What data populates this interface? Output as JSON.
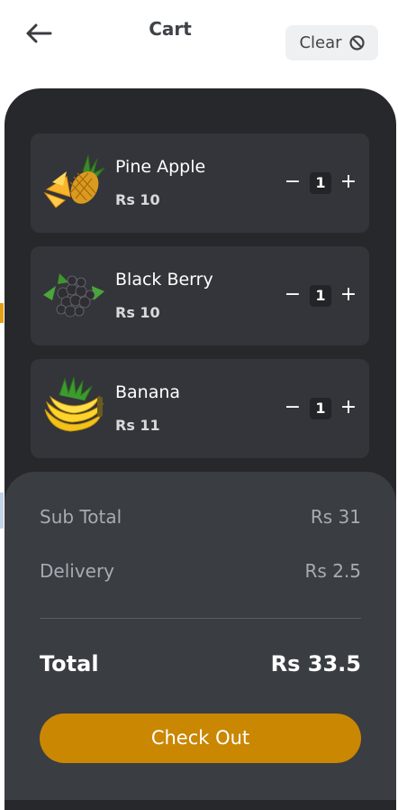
{
  "header": {
    "title": "Cart",
    "clear_label": "Clear",
    "back_icon": "arrow-left-icon",
    "clear_icon": "slash-circle-icon"
  },
  "items": [
    {
      "name": "Pine Apple",
      "price": "Rs 10",
      "quantity": "1",
      "image_icon": "pineapple-image"
    },
    {
      "name": "Black Berry",
      "price": "Rs 10",
      "quantity": "1",
      "image_icon": "blackberry-image"
    },
    {
      "name": "Banana",
      "price": "Rs 11",
      "quantity": "1",
      "image_icon": "banana-image"
    }
  ],
  "qty_controls": {
    "minus": "−",
    "plus": "+"
  },
  "summary": {
    "subtotal_label": "Sub Total",
    "subtotal_value": "Rs 31",
    "delivery_label": "Delivery",
    "delivery_value": "Rs 2.5",
    "total_label": "Total",
    "total_value": "Rs 33.5",
    "checkout_label": "Check Out"
  },
  "colors": {
    "accent": "#c98702",
    "panel": "#27282b",
    "card": "#34353a",
    "summary": "#3a3d42"
  }
}
